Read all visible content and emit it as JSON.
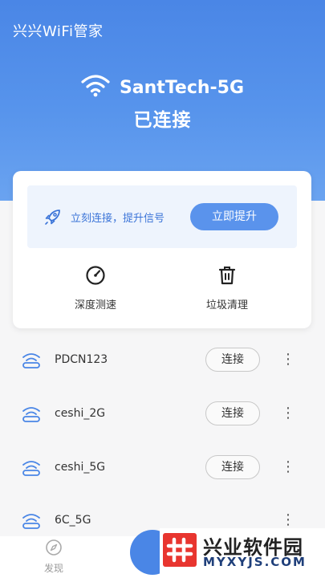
{
  "app": {
    "title": "兴兴WiFi管家"
  },
  "connection": {
    "ssid": "SantTech-5G",
    "status": "已连接"
  },
  "boost": {
    "text": "立刻连接，提升信号",
    "button_label": "立即提升"
  },
  "tools": [
    {
      "label": "深度测速",
      "icon": "speedometer-icon"
    },
    {
      "label": "垃圾清理",
      "icon": "trash-icon"
    }
  ],
  "networks": [
    {
      "name": "PDCN123",
      "action": "连接"
    },
    {
      "name": "ceshi_2G",
      "action": "连接"
    },
    {
      "name": "ceshi_5G",
      "action": "连接"
    },
    {
      "name": "6C_5G",
      "action": ""
    }
  ],
  "nav": {
    "discover_label": "发现"
  },
  "watermark": {
    "title": "兴业软件园",
    "url": "MYXYJS.COM"
  },
  "colors": {
    "primary": "#4a86e6",
    "accent_text": "#3b74d8",
    "boost_button": "#5a93ec"
  }
}
